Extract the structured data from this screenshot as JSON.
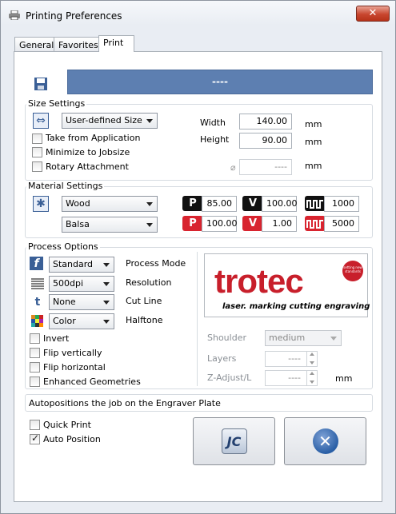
{
  "window": {
    "title": "Printing Preferences",
    "close_glyph": "✕"
  },
  "tabs": [
    "General",
    "Favorites",
    "Print"
  ],
  "job": {
    "name": "----"
  },
  "size": {
    "group": "Size Settings",
    "mode": "User-defined Size",
    "take_from_application": "Take from Application",
    "minimize": "Minimize to Jobsize",
    "rotary": "Rotary Attachment",
    "width_label": "Width",
    "width": "140.00",
    "height_label": "Height",
    "height": "90.00",
    "diameter": "----",
    "diameter_symbol": "⌀",
    "unit": "mm"
  },
  "material": {
    "group": "Material Settings",
    "material": "Wood",
    "type": "Balsa",
    "row1": {
      "power": "85.00",
      "velocity": "100.00",
      "frequency": "1000"
    },
    "row2": {
      "power": "100.00",
      "velocity": "1.00",
      "frequency": "5000"
    },
    "badges": {
      "power": "P",
      "velocity": "V"
    }
  },
  "process": {
    "group": "Process Options",
    "mode": "Standard",
    "mode_label": "Process Mode",
    "resolution": "500dpi",
    "resolution_label": "Resolution",
    "cutline": "None",
    "cutline_label": "Cut Line",
    "halftone": "Color",
    "halftone_label": "Halftone",
    "invert": "Invert",
    "flip_v": "Flip vertically",
    "flip_h": "Flip horizontal",
    "enhanced": "Enhanced Geometries",
    "shoulder_label": "Shoulder",
    "shoulder": "medium",
    "layers_label": "Layers",
    "layers": "----",
    "zadjust_label": "Z-Adjust/L",
    "zadjust": "----",
    "unit": "mm"
  },
  "logo": {
    "brand": "trotec",
    "tagline": "laser. marking cutting engraving",
    "seal": "setting new standards"
  },
  "status": "Autopositions the job on the Engraver Plate",
  "bottom": {
    "quick_print": "Quick Print",
    "auto_position": "Auto Position",
    "auto_position_checked": true
  },
  "icons": {
    "print": "printer-icon",
    "save": "save-icon",
    "size": "resize-icon",
    "material": "material-icon",
    "jc": "JC"
  },
  "colors": {
    "job_bar": "#5d7fb1",
    "badge_black": "#111111",
    "badge_red": "#d8242f",
    "cancel": "#2a5fa6"
  }
}
